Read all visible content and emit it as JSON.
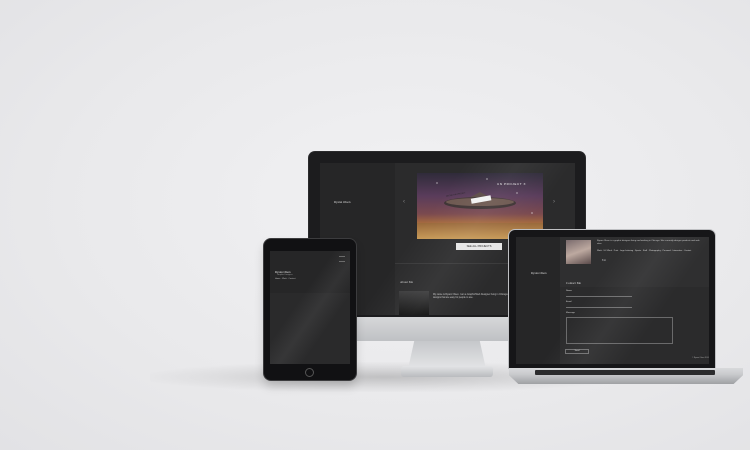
{
  "devices": {
    "imac": {
      "logo": "Ryann Olsen",
      "hero_label": "UN PROJECT X",
      "hero_sign": "DECIDE THE PROJECT",
      "prev_arrow": "‹",
      "next_arrow": "›",
      "button_label": "SEE ALL PROJECTS",
      "section_title": "About Me",
      "body_text": "My name is Ryann Olsen. I am a Graphic/Web Designer living in Chicago. I specialize in producing clean and simple designs that are easy for people to use."
    },
    "tablet": {
      "logo": "Ryann Olsen",
      "subtitle": "Graphic Designer",
      "nav": "Home · Work · Contact"
    },
    "laptop": {
      "logo": "Ryann Olsen",
      "bio": "Ryann Olsen is a graphic designer living and working in Chicago. She currently designs products and web sites.",
      "links": "Work · UX Work · Print · Logo Lettering · Sports · Stuff · Photography · Personal · Interactive · Contact",
      "social": "f  in",
      "contact_title": "Contact Me",
      "name_label": "Name",
      "email_label": "Email",
      "message_label": "Message",
      "send_label": "Send",
      "copyright": "© Ryann Olsen 2014"
    }
  }
}
